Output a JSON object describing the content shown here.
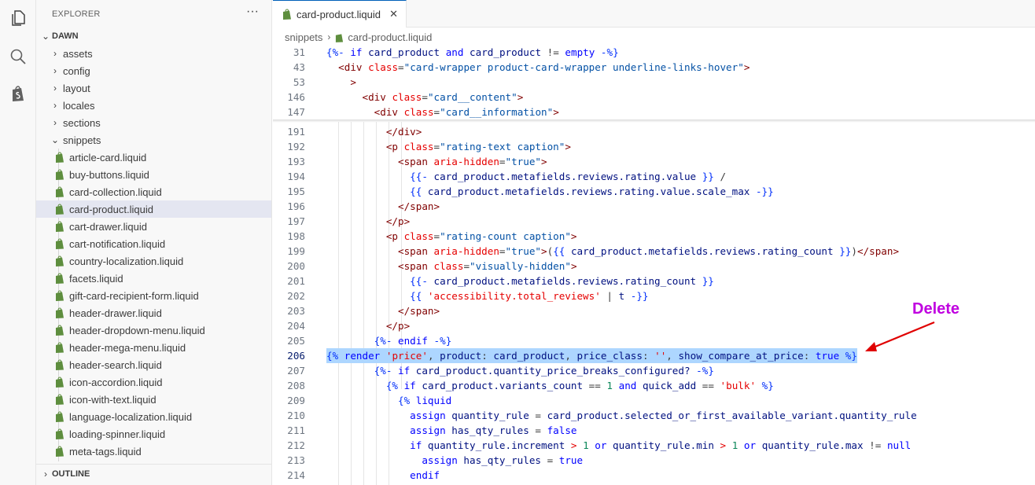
{
  "colors": {
    "accent": "#005fb8",
    "annotation": "#c000e0",
    "arrow": "#e00000",
    "highlight": "#add6ff",
    "selected_row": "#e4e6f1"
  },
  "activity_bar": {
    "icons": [
      "files-icon",
      "search-icon",
      "shopify-icon"
    ]
  },
  "explorer": {
    "title": "EXPLORER",
    "more": "···",
    "root": "DAWN",
    "folders": [
      "assets",
      "config",
      "layout",
      "locales",
      "sections",
      "snippets"
    ],
    "files": [
      "article-card.liquid",
      "buy-buttons.liquid",
      "card-collection.liquid",
      "card-product.liquid",
      "cart-drawer.liquid",
      "cart-notification.liquid",
      "country-localization.liquid",
      "facets.liquid",
      "gift-card-recipient-form.liquid",
      "header-drawer.liquid",
      "header-dropdown-menu.liquid",
      "header-mega-menu.liquid",
      "header-search.liquid",
      "icon-accordion.liquid",
      "icon-with-text.liquid",
      "language-localization.liquid",
      "loading-spinner.liquid",
      "meta-tags.liquid"
    ],
    "selected_file": "card-product.liquid",
    "outline": "OUTLINE"
  },
  "editor": {
    "tab": "card-product.liquid",
    "breadcrumb": [
      "snippets",
      "card-product.liquid"
    ],
    "sticky_line_numbers": [
      "31",
      "43",
      "53",
      "146",
      "147"
    ],
    "line_numbers": [
      "191",
      "192",
      "193",
      "194",
      "195",
      "196",
      "197",
      "198",
      "199",
      "200",
      "201",
      "202",
      "203",
      "204",
      "205",
      "206",
      "207",
      "208",
      "209",
      "210",
      "211",
      "212",
      "213",
      "214"
    ],
    "active_line": "206"
  },
  "annotation": {
    "label": "Delete"
  }
}
